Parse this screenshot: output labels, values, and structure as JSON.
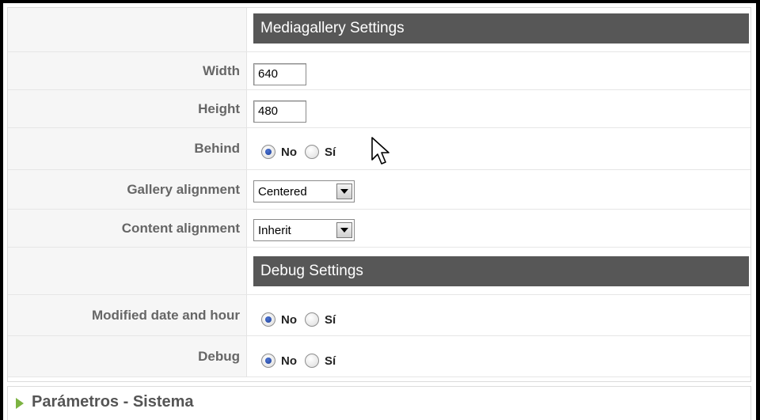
{
  "sections": {
    "mediagallery_title": "Mediagallery Settings",
    "debug_title": "Debug Settings"
  },
  "fields": {
    "width": {
      "label": "Width",
      "value": "640"
    },
    "height": {
      "label": "Height",
      "value": "480"
    },
    "behind": {
      "label": "Behind",
      "options": [
        "No",
        "Sí"
      ],
      "selected": "No"
    },
    "gallery_alignment": {
      "label": "Gallery alignment",
      "value": "Centered"
    },
    "content_alignment": {
      "label": "Content alignment",
      "value": "Inherit"
    },
    "modified_date": {
      "label": "Modified date and hour",
      "options": [
        "No",
        "Sí"
      ],
      "selected": "No"
    },
    "debug": {
      "label": "Debug",
      "options": [
        "No",
        "Sí"
      ],
      "selected": "No"
    }
  },
  "footer": {
    "label": "Parámetros - Sistema"
  },
  "colors": {
    "section_bar": "#575757",
    "label_text": "#666666",
    "footer_arrow": "#7cb342"
  },
  "icons": {
    "cursor": "mouse-pointer-icon",
    "expand": "expand-arrow-icon",
    "dropdown": "chevron-down-icon"
  }
}
